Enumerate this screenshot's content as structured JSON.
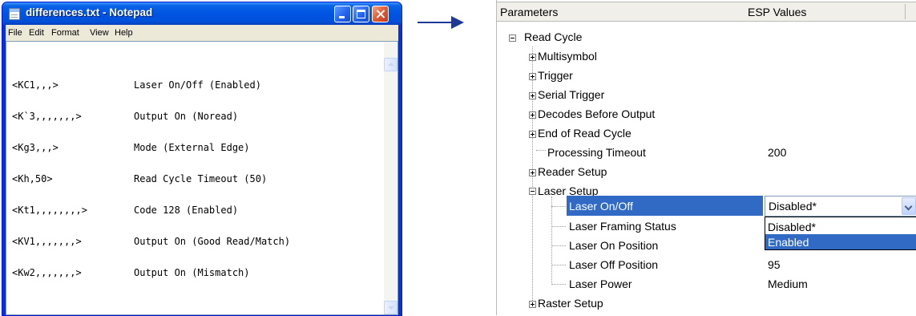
{
  "notepad": {
    "title": "differences.txt - Notepad",
    "menu": [
      "File",
      "Edit",
      "Format",
      "View",
      "Help"
    ],
    "lines": [
      {
        "code": "<KC1,,,>",
        "desc": "Laser On/Off (Enabled)"
      },
      {
        "code": "<K`3,,,,,,,>",
        "desc": "Output On (Noread)"
      },
      {
        "code": "<Kg3,,,>",
        "desc": "Mode (External Edge)"
      },
      {
        "code": "<Kh,50>",
        "desc": "Read Cycle Timeout (50)"
      },
      {
        "code": "<Kt1,,,,,,,,>",
        "desc": "Code 128 (Enabled)"
      },
      {
        "code": "<KV1,,,,,,,>",
        "desc": "Output On (Good Read/Match)"
      },
      {
        "code": "<Kw2,,,,,,,>",
        "desc": "Output On (Mismatch)"
      }
    ]
  },
  "params": {
    "header": {
      "col1": "Parameters",
      "col2": "ESP Values"
    },
    "root": "Read Cycle",
    "items": [
      {
        "label": "Multisymbol"
      },
      {
        "label": "Trigger"
      },
      {
        "label": "Serial Trigger"
      },
      {
        "label": "Decodes Before Output"
      },
      {
        "label": "End of Read Cycle"
      },
      {
        "label": "Processing Timeout",
        "value": "200"
      },
      {
        "label": "Reader Setup"
      },
      {
        "label": "Laser Setup"
      }
    ],
    "laser_children": [
      {
        "label": "Laser On/Off",
        "value": "Disabled*"
      },
      {
        "label": "Laser Framing Status",
        "value": ""
      },
      {
        "label": "Laser On Position",
        "value": ""
      },
      {
        "label": "Laser Off Position",
        "value": "95"
      },
      {
        "label": "Laser Power",
        "value": "Medium"
      }
    ],
    "after": {
      "label": "Raster Setup"
    },
    "dropdown_options": [
      "Disabled*",
      "Enabled"
    ],
    "dropdown_highlight": "Enabled"
  },
  "colors": {
    "selection": "#316ac5",
    "arrow": "#1e3a96"
  }
}
